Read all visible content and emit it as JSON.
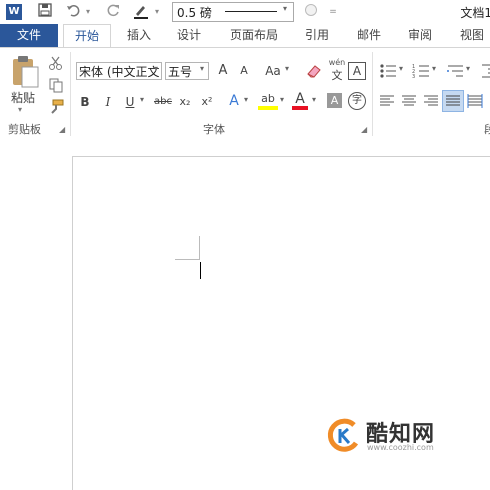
{
  "quick_access": {
    "border_weight": "0.5 磅",
    "doc_title": "文档1"
  },
  "tabs": [
    "文件",
    "开始",
    "插入",
    "设计",
    "页面布局",
    "引用",
    "邮件",
    "审阅",
    "视图"
  ],
  "ribbon": {
    "clipboard": {
      "paste_label": "粘贴",
      "group_label": "剪贴板"
    },
    "font": {
      "font_name": "宋体 (中文正文",
      "font_size": "五号",
      "grow": "A",
      "shrink": "A",
      "change_case": "Aa",
      "phonetic_top": "wén",
      "phonetic_bottom": "文",
      "char_border": "A",
      "bold": "B",
      "italic": "I",
      "underline": "U",
      "strikethrough": "abc",
      "subscript": "x₂",
      "superscript": "x²",
      "text_effect": "A",
      "highlight": "ab",
      "font_color": "A",
      "char_shading": "A",
      "enclose": "字",
      "group_label": "字体"
    },
    "paragraph": {
      "group_label": "段"
    }
  },
  "watermark": {
    "brand": "酷知网",
    "url": "www.coozhi.com"
  },
  "colors": {
    "accent": "#2b579a",
    "highlight_yellow": "#ffff00",
    "font_red": "#e81123",
    "watermark_orange": "#f08c28",
    "watermark_blue": "#2a7ac8"
  }
}
